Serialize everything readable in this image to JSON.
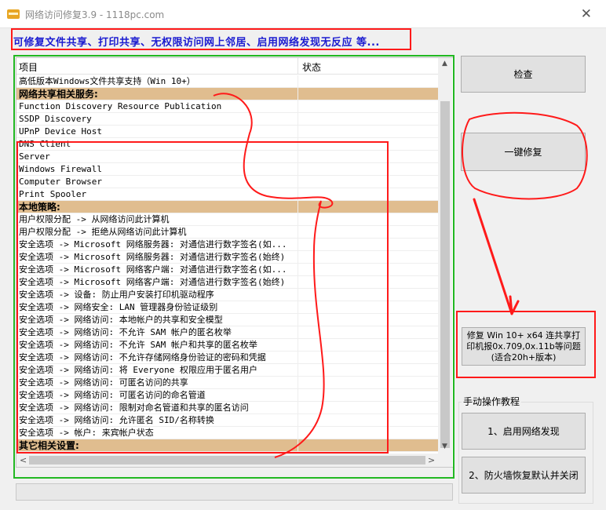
{
  "window": {
    "title": "网络访问修复3.9 - 1118pc.com",
    "close_glyph": "✕"
  },
  "tip": "可修复文件共享、打印共享、无权限访问网上邻居、启用网络发现无反应  等...",
  "list": {
    "headers": [
      "项目",
      "状态"
    ],
    "rows": [
      {
        "text": "高低版本Windows文件共享支持（Win 10+）",
        "group": false
      },
      {
        "text": "网络共享相关服务:",
        "group": true
      },
      {
        "text": "Function Discovery Resource Publication",
        "group": false
      },
      {
        "text": "SSDP Discovery",
        "group": false
      },
      {
        "text": "UPnP Device Host",
        "group": false
      },
      {
        "text": "DNS Client",
        "group": false
      },
      {
        "text": "Server",
        "group": false
      },
      {
        "text": "Windows Firewall",
        "group": false
      },
      {
        "text": "Computer Browser",
        "group": false
      },
      {
        "text": "Print Spooler",
        "group": false
      },
      {
        "text": "本地策略:",
        "group": true
      },
      {
        "text": "用户权限分配 -> 从网络访问此计算机",
        "group": false
      },
      {
        "text": "用户权限分配 -> 拒绝从网络访问此计算机",
        "group": false
      },
      {
        "text": "安全选项 -> Microsoft 网络服务器: 对通信进行数字签名(如...",
        "group": false
      },
      {
        "text": "安全选项 -> Microsoft 网络服务器: 对通信进行数字签名(始终)",
        "group": false
      },
      {
        "text": "安全选项 -> Microsoft 网络客户端: 对通信进行数字签名(如...",
        "group": false
      },
      {
        "text": "安全选项 -> Microsoft 网络客户端: 对通信进行数字签名(始终)",
        "group": false
      },
      {
        "text": "安全选项 -> 设备: 防止用户安装打印机驱动程序",
        "group": false
      },
      {
        "text": "安全选项 -> 网络安全: LAN 管理器身份验证级别",
        "group": false
      },
      {
        "text": "安全选项 -> 网络访问: 本地帐户的共享和安全模型",
        "group": false
      },
      {
        "text": "安全选项 -> 网络访问: 不允许 SAM 帐户的匿名枚举",
        "group": false
      },
      {
        "text": "安全选项 -> 网络访问: 不允许 SAM 帐户和共享的匿名枚举",
        "group": false
      },
      {
        "text": "安全选项 -> 网络访问: 不允许存储网络身份验证的密码和凭据",
        "group": false
      },
      {
        "text": "安全选项 -> 网络访问: 将 Everyone 权限应用于匿名用户",
        "group": false
      },
      {
        "text": "安全选项 -> 网络访问: 可匿名访问的共享",
        "group": false
      },
      {
        "text": "安全选项 -> 网络访问: 可匿名访问的命名管道",
        "group": false
      },
      {
        "text": "安全选项 -> 网络访问: 限制对命名管道和共享的匿名访问",
        "group": false
      },
      {
        "text": "安全选项 -> 网络访问: 允许匿名 SID/名称转换",
        "group": false
      },
      {
        "text": "安全选项 -> 帐户: 来宾帐户状态",
        "group": false
      },
      {
        "text": "其它相关设置:",
        "group": true
      }
    ]
  },
  "buttons": {
    "check": "检查",
    "oneclick": "一键修复",
    "win10fix": "修复 Win 10+ x64 连共享打印机报0x.709,0x.11b等问题(适合20h+版本)",
    "manual_label": "手动操作教程",
    "enable_discovery": "1、启用网络发现",
    "firewall_reset": "2、防火墙恢复默认并关闭"
  },
  "icons": {
    "scroll_up": "▲",
    "scroll_down": "▼",
    "scroll_left": "<",
    "scroll_right": ">"
  },
  "colors": {
    "annotation_red": "#ff1a1a",
    "annotation_green": "#22b822",
    "group_row": "#e0bd8f",
    "tip_text": "#1a1ad0"
  }
}
